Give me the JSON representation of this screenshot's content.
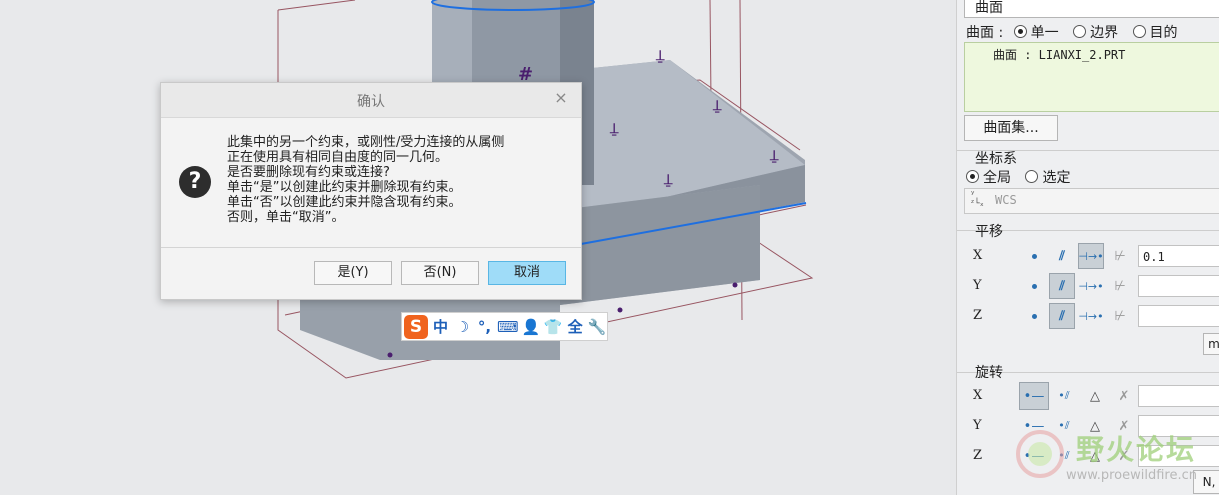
{
  "dialog": {
    "title": "确认",
    "close_glyph": "×",
    "icon_glyph": "?",
    "message": [
      "此集中的另一个约束，或刚性/受力连接的从属侧",
      "正在使用具有相同自由度的同一几何。",
      "是否要删除现有约束或连接?",
      "单击“是”以创建此约束并删除现有约束。",
      "单击“否”以创建此约束并隐含现有约束。",
      "否则，单击“取消”。"
    ],
    "buttons": {
      "yes": "是(Y)",
      "no": "否(N)",
      "cancel": "取消"
    }
  },
  "ime_toolbar": {
    "logo": "S",
    "items": [
      "中",
      "☽",
      "°,",
      "⌨",
      "👤",
      "👕",
      "全",
      "🔧"
    ]
  },
  "panel": {
    "surface_dropdown": "曲面",
    "surface_mode_label": "曲面 :",
    "surface_modes": [
      "单一",
      "边界",
      "目的"
    ],
    "surface_list_item": "曲面 : LIANXI_2.PRT",
    "surface_set_button": "曲面集...",
    "coord_section": "坐标系",
    "coord_modes": [
      "全局",
      "选定"
    ],
    "coord_value": "WCS",
    "translate_section": "平移",
    "translate_axes": [
      {
        "axis": "X",
        "value": "0.1"
      },
      {
        "axis": "Y",
        "value": ""
      },
      {
        "axis": "Z",
        "value": ""
      }
    ],
    "more_button": "m",
    "rotate_section": "旋转",
    "rotate_axes": [
      {
        "axis": "X",
        "value": ""
      },
      {
        "axis": "Y",
        "value": ""
      },
      {
        "axis": "Z",
        "value": ""
      }
    ],
    "rotate_trailing_text": "N,"
  },
  "watermark": {
    "cn": "野火论坛",
    "url": "www.proewildfire.cn"
  },
  "colors": {
    "cancel_button": "#9fdcf8",
    "sogou_logo": "#f0631e",
    "model_edge_blue": "#1e6fe0",
    "constraint_marker": "#4a1e6e"
  }
}
